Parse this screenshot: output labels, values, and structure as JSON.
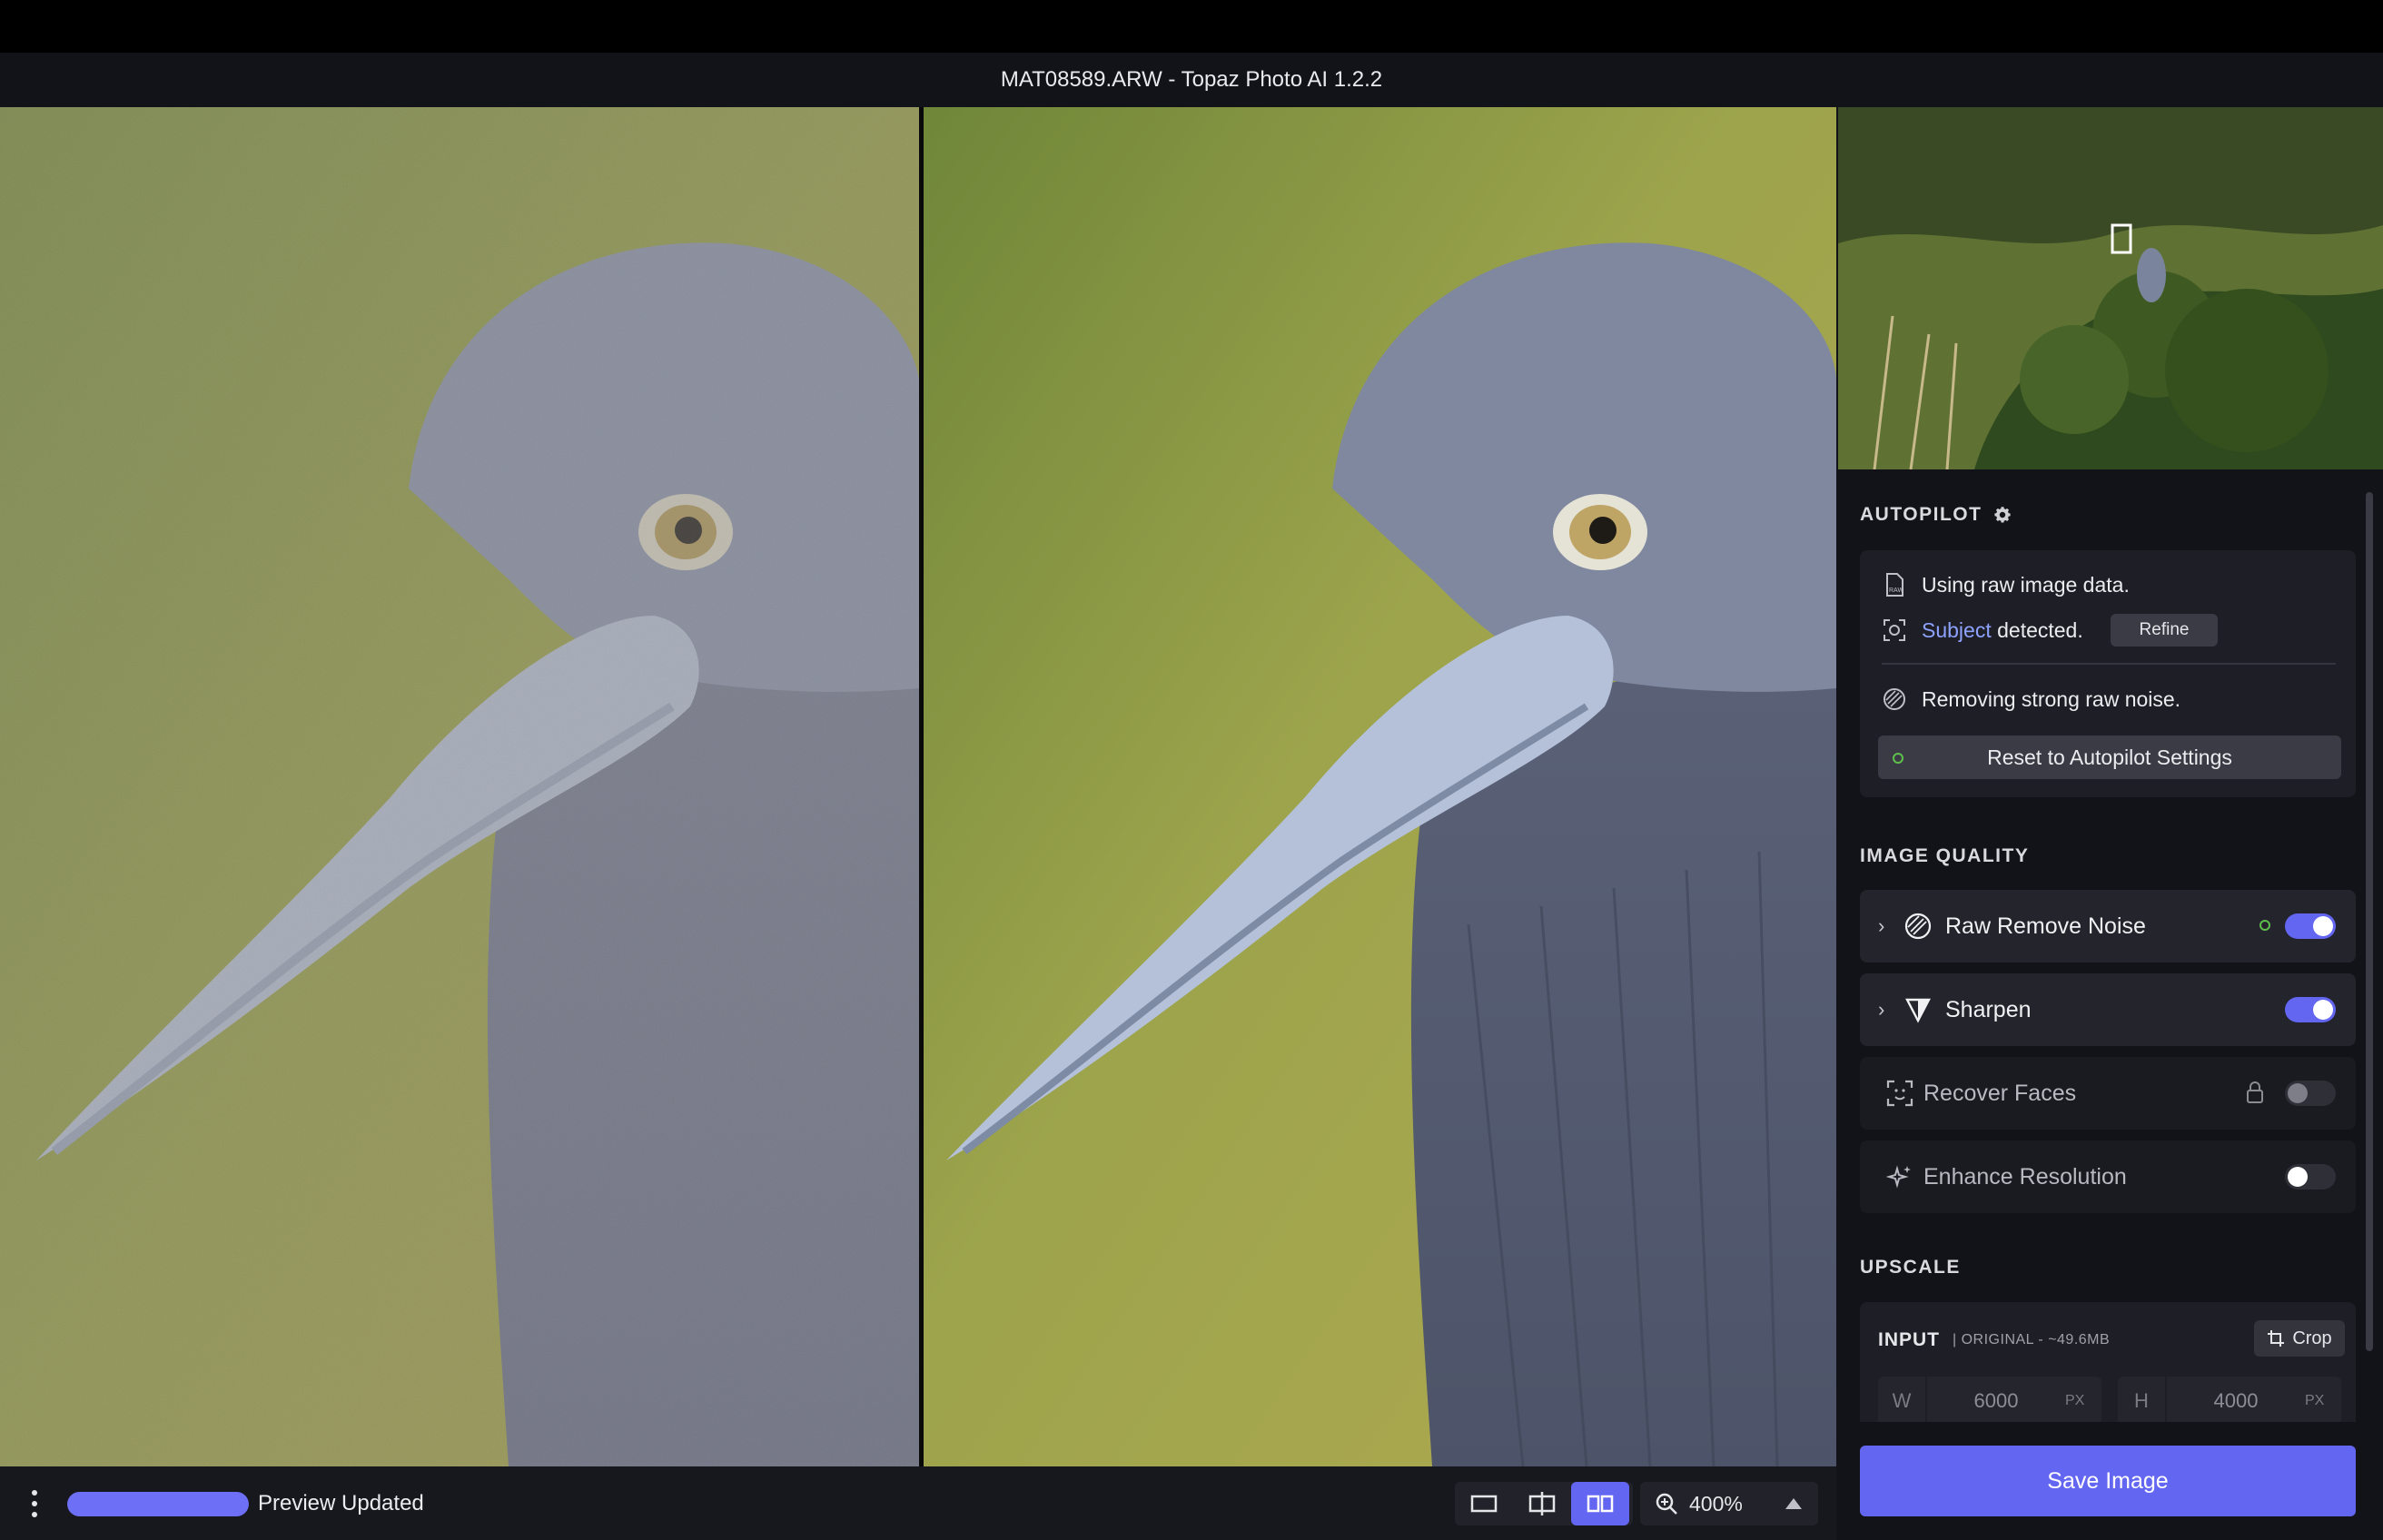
{
  "window": {
    "title": "MAT08589.ARW - Topaz Photo AI 1.2.2"
  },
  "bottom_bar": {
    "status": "Preview Updated",
    "progress": 1.0,
    "view_modes": [
      "single-view",
      "split-view",
      "side-by-side-view"
    ],
    "active_view_mode": "side-by-side-view",
    "zoom": "400%"
  },
  "sidebar": {
    "autopilot": {
      "title": "AUTOPILOT",
      "raw_data": "Using raw image data.",
      "subject_link": "Subject",
      "subject_rest": "detected.",
      "refine_label": "Refine",
      "noise_msg": "Removing strong raw noise.",
      "reset_label": "Reset to Autopilot Settings"
    },
    "image_quality": {
      "title": "IMAGE QUALITY",
      "features": [
        {
          "label": "Raw Remove Noise",
          "enabled": true,
          "expandable": true,
          "icon": "noise-icon"
        },
        {
          "label": "Sharpen",
          "enabled": true,
          "expandable": true,
          "icon": "sharpen-icon"
        },
        {
          "label": "Recover Faces",
          "enabled": false,
          "locked": true,
          "icon": "face-icon"
        },
        {
          "label": "Enhance Resolution",
          "enabled": false,
          "icon": "sparkle-icon"
        }
      ]
    },
    "upscale": {
      "title": "UPSCALE",
      "input_label": "INPUT",
      "input_sub": "| ORIGINAL - ~49.6MB",
      "crop_label": "Crop",
      "width_key": "W",
      "width": "6000",
      "height_key": "H",
      "height": "4000",
      "unit": "PX"
    },
    "save_label": "Save Image"
  },
  "colors": {
    "accent": "#6366f1",
    "status_green": "#5fbf4c",
    "link": "#8ea2ff"
  }
}
